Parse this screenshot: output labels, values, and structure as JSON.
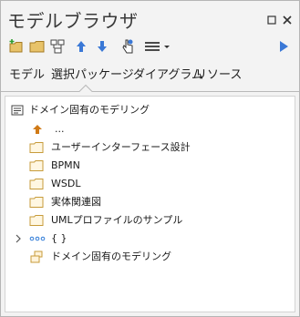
{
  "title": "モデルブラウザ",
  "window_buttons": {
    "pin_icon": "pin-icon",
    "close_icon": "close-icon"
  },
  "toolbar": {
    "icons": [
      "new-package-icon",
      "folder-icon",
      "diagram-icon",
      "move-up-icon",
      "move-down-icon",
      "locate-icon",
      "menu-icon",
      "play-icon"
    ]
  },
  "tabs": [
    {
      "label": "モデル"
    },
    {
      "label": "選択パッケージ"
    },
    {
      "label": "ダイアグラム"
    },
    {
      "label": "リソース"
    }
  ],
  "tree": {
    "root_label": "ドメイン固有のモデリング",
    "up_label": "...",
    "folders": [
      {
        "label": "ユーザーインターフェース設計"
      },
      {
        "label": "BPMN"
      },
      {
        "label": "WSDL"
      },
      {
        "label": "実体関連図"
      },
      {
        "label": "UMLプロファイルのサンプル"
      }
    ],
    "group_label": "{ }",
    "package_label": "ドメイン固有のモデリング"
  },
  "colors": {
    "accent": "#2f7bd8",
    "folder": "#c79b3a",
    "up_arrow": "#d07a16"
  }
}
